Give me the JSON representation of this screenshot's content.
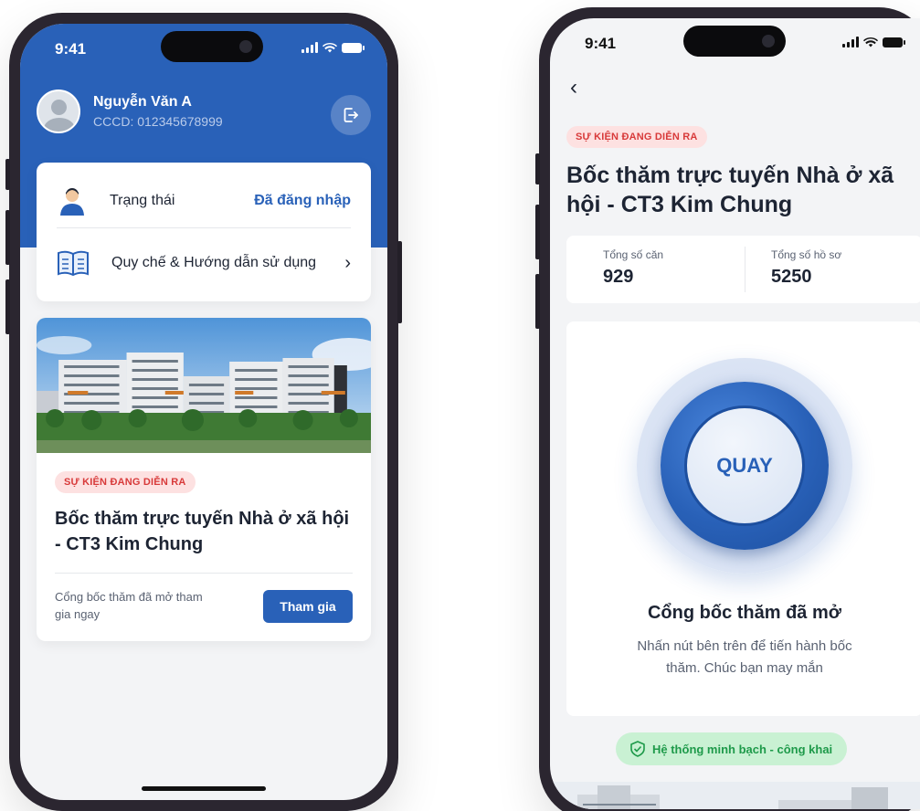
{
  "status_bar": {
    "time": "9:41"
  },
  "left": {
    "user": {
      "name": "Nguyễn Văn A",
      "id_line": "CCCD: 012345678999"
    },
    "status_row": {
      "label": "Trạng thái",
      "value": "Đã đăng nhập"
    },
    "guide_row": {
      "label": "Quy chế & Hướng dẫn sử dụng",
      "chevron": "›"
    },
    "event": {
      "badge": "SỰ KIỆN ĐANG DIỄN RA",
      "title": "Bốc thăm trực tuyến Nhà ở xã hội - CT3 Kim Chung",
      "desc": "Cổng bốc thăm đã mở tham gia ngay",
      "join_label": "Tham gia"
    }
  },
  "right": {
    "back": "‹",
    "badge": "SỰ KIỆN ĐANG DIỄN RA",
    "title": "Bốc thăm trực tuyến Nhà ở xã hội - CT3 Kim Chung",
    "stats": [
      {
        "label": "Tổng số căn",
        "value": "929"
      },
      {
        "label": "Tổng số hồ sơ",
        "value": "5250"
      }
    ],
    "spin_label": "QUAY",
    "spin_title": "Cổng bốc thăm đã mở",
    "spin_desc": "Nhấn nút bên trên để tiến hành bốc thăm. Chúc bạn may mắn",
    "trust_label": "Hệ thống minh bạch - công khai"
  },
  "colors": {
    "primary": "#2961b8",
    "badge_bg": "#fde1e1",
    "badge_fg": "#d83a3a",
    "trust_bg": "#c9f1d3",
    "trust_fg": "#1e9a4a"
  }
}
